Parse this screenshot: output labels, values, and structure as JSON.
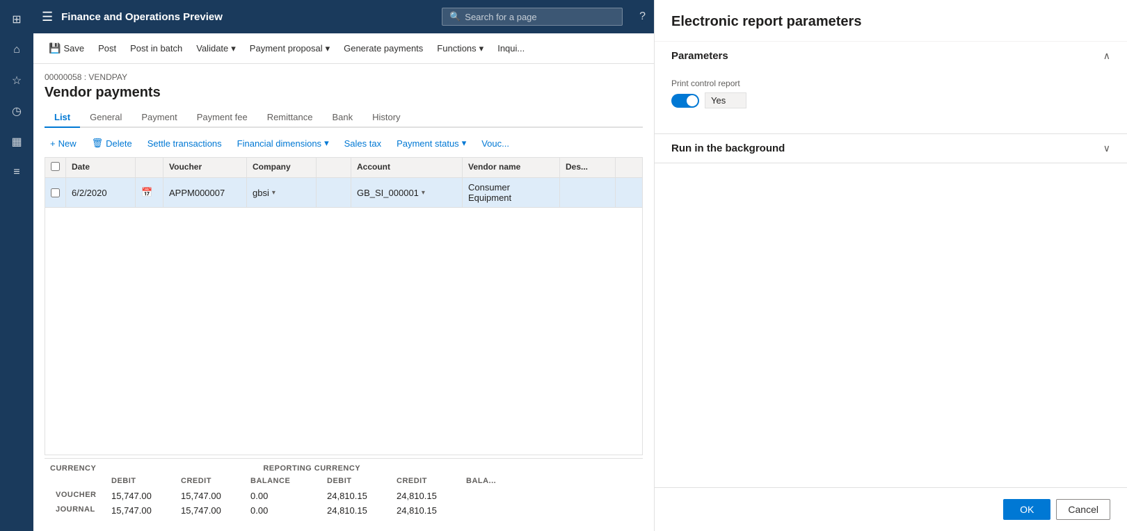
{
  "app": {
    "title": "Finance and Operations Preview",
    "search_placeholder": "Search for a page"
  },
  "sidebar": {
    "icons": [
      {
        "name": "grid-icon",
        "glyph": "⊞"
      },
      {
        "name": "home-icon",
        "glyph": "⌂"
      },
      {
        "name": "star-icon",
        "glyph": "☆"
      },
      {
        "name": "clock-icon",
        "glyph": "◷"
      },
      {
        "name": "table-icon",
        "glyph": "▦"
      },
      {
        "name": "list-icon",
        "glyph": "≡"
      }
    ]
  },
  "toolbar": {
    "buttons": [
      {
        "name": "save-button",
        "label": "Save",
        "icon": "💾"
      },
      {
        "name": "post-button",
        "label": "Post",
        "icon": ""
      },
      {
        "name": "post-batch-button",
        "label": "Post in batch",
        "icon": ""
      },
      {
        "name": "validate-button",
        "label": "Validate",
        "icon": "",
        "hasDropdown": true
      },
      {
        "name": "payment-proposal-button",
        "label": "Payment proposal",
        "icon": "",
        "hasDropdown": true
      },
      {
        "name": "generate-payments-button",
        "label": "Generate payments",
        "icon": ""
      },
      {
        "name": "functions-button",
        "label": "Functions",
        "icon": "",
        "hasDropdown": true
      },
      {
        "name": "inquiries-button",
        "label": "Inqui...",
        "icon": ""
      }
    ]
  },
  "page": {
    "breadcrumb": "00000058 : VENDPAY",
    "title": "Vendor payments"
  },
  "tabs": [
    {
      "name": "list-tab",
      "label": "List",
      "active": true
    },
    {
      "name": "general-tab",
      "label": "General",
      "active": false
    },
    {
      "name": "payment-tab",
      "label": "Payment",
      "active": false
    },
    {
      "name": "payment-fee-tab",
      "label": "Payment fee",
      "active": false
    },
    {
      "name": "remittance-tab",
      "label": "Remittance",
      "active": false
    },
    {
      "name": "bank-tab",
      "label": "Bank",
      "active": false
    },
    {
      "name": "history-tab",
      "label": "History",
      "active": false
    }
  ],
  "actions": [
    {
      "name": "new-action",
      "label": "New",
      "icon": "+"
    },
    {
      "name": "delete-action",
      "label": "Delete",
      "icon": "🗑"
    },
    {
      "name": "settle-transactions-action",
      "label": "Settle transactions",
      "icon": ""
    },
    {
      "name": "financial-dimensions-action",
      "label": "Financial dimensions",
      "icon": "",
      "hasDropdown": true
    },
    {
      "name": "sales-tax-action",
      "label": "Sales tax",
      "icon": ""
    },
    {
      "name": "payment-status-action",
      "label": "Payment status",
      "icon": "",
      "hasDropdown": true
    },
    {
      "name": "vouch-action",
      "label": "Vouc...",
      "icon": ""
    }
  ],
  "grid": {
    "columns": [
      {
        "name": "check-col",
        "label": ""
      },
      {
        "name": "date-col",
        "label": "Date"
      },
      {
        "name": "cal-col",
        "label": ""
      },
      {
        "name": "voucher-col",
        "label": "Voucher"
      },
      {
        "name": "company-col",
        "label": "Company"
      },
      {
        "name": "account-col-arrow",
        "label": ""
      },
      {
        "name": "account-col",
        "label": "Account"
      },
      {
        "name": "vendor-col",
        "label": "Vendor name"
      },
      {
        "name": "desc-col",
        "label": "Des..."
      }
    ],
    "rows": [
      {
        "check": "",
        "date": "6/2/2020",
        "cal": "📅",
        "voucher": "APPM000007",
        "company": "gbsi",
        "company_arrow": "▾",
        "account": "GB_SI_000001",
        "account_arrow": "▾",
        "vendor": "Consumer Equipment",
        "desc": ""
      }
    ]
  },
  "footer": {
    "currency_label": "CURRENCY",
    "reporting_currency_label": "REPORTING CURRENCY",
    "cols_currency": [
      "DEBIT",
      "CREDIT",
      "BALANCE"
    ],
    "cols_reporting": [
      "DEBIT",
      "CREDIT",
      "BALA..."
    ],
    "rows": [
      {
        "label": "VOUCHER",
        "debit": "15,747.00",
        "credit": "15,747.00",
        "balance": "0.00",
        "r_debit": "24,810.15",
        "r_credit": "24,810.15",
        "r_balance": ""
      },
      {
        "label": "JOURNAL",
        "debit": "15,747.00",
        "credit": "15,747.00",
        "balance": "0.00",
        "r_debit": "24,810.15",
        "r_credit": "24,810.15",
        "r_balance": ""
      }
    ]
  },
  "panel": {
    "title": "Electronic report parameters",
    "sections": [
      {
        "name": "parameters-section",
        "title": "Parameters",
        "expanded": true,
        "fields": [
          {
            "name": "print-control-report-field",
            "label": "Print control report",
            "type": "toggle",
            "value": "Yes",
            "checked": true
          }
        ]
      },
      {
        "name": "run-background-section",
        "title": "Run in the background",
        "expanded": false
      }
    ],
    "ok_label": "OK",
    "cancel_label": "Cancel"
  }
}
